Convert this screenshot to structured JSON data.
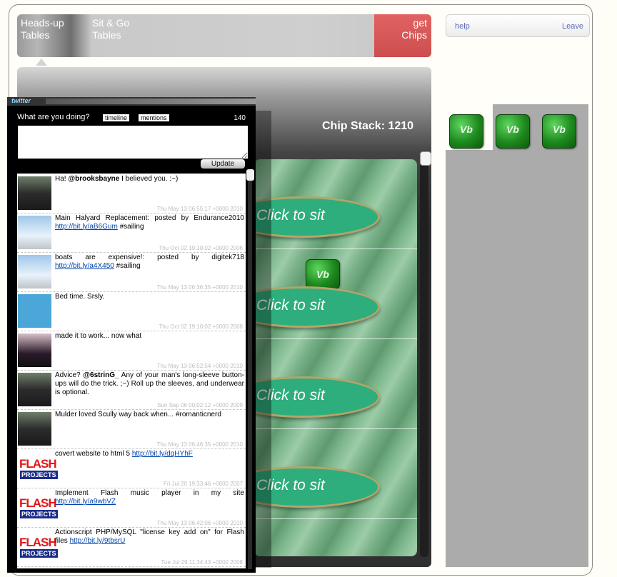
{
  "nav": {
    "headsup": "Heads-up Tables",
    "sitgo": "Sit & Go Tables",
    "getchips": "get Chips"
  },
  "account": {
    "help": "help",
    "leave": "Leave"
  },
  "game": {
    "chip_stack": "Chip Stack: 1210",
    "seats": [
      "Click to sit",
      "Click to sit",
      "Click to sit",
      "Click to sit"
    ],
    "chip_icon_glyph": "Vb"
  },
  "twitter": {
    "logo": "twitter",
    "prompt": "What are you doing?",
    "tabs": [
      "timeline",
      "mentions"
    ],
    "char_count": "140",
    "update_label": "Update",
    "tweets": [
      {
        "avatar": "photo",
        "pre": "Ha! ",
        "bold": "@brooksbayne",
        "post": "  I believed you. :~)",
        "link": "",
        "tail": "",
        "time": "Thu May 13 06:55:17 +0000 2010"
      },
      {
        "avatar": "boat",
        "pre": "Main Halyard Replacement: posted by Endurance2010 ",
        "bold": "",
        "post": "",
        "link": "http://bit.ly/aB6Gum",
        "tail": " #sailing",
        "time": "Thu Oct 02 19:10:02 +0000 2008"
      },
      {
        "avatar": "boat",
        "pre": "boats are expensive!: posted by digitek718 ",
        "bold": "",
        "post": "",
        "link": "http://bit.ly/a4X450",
        "tail": " #sailing",
        "time": "Thu May 13 06:36:35 +0000 2010"
      },
      {
        "avatar": "duck",
        "pre": "Bed time. Srsly.",
        "bold": "",
        "post": "",
        "link": "",
        "tail": "",
        "time": "Thu Oct 02 19:10:02 +0000 2008"
      },
      {
        "avatar": "girl",
        "pre": "made it to work... now what",
        "bold": "",
        "post": "",
        "link": "",
        "tail": "",
        "time": "Thu May 13 06:52:54 +0000 2010"
      },
      {
        "avatar": "photo",
        "pre": "Advice? ",
        "bold": "@6strinG_",
        "post": "  Any of your man's long-sleeve button-ups will do the trick. ;~) Roll up the sleeves, and underwear is optional.",
        "link": "",
        "tail": "",
        "time": "Sun Sep 06 00:02:12 +0000 2009"
      },
      {
        "avatar": "photo",
        "pre": "Mulder loved Scully way back when... #romanticnerd",
        "bold": "",
        "post": "",
        "link": "",
        "tail": "",
        "time": "Thu May 13 06:46:35 +0000 2010"
      },
      {
        "avatar": "flash",
        "pre": "covert website to html 5 ",
        "bold": "",
        "post": "",
        "link": "http://bit.ly/dqHYhF",
        "tail": "",
        "time": "Fri Jul 20 19:33:46 +0000 2007"
      },
      {
        "avatar": "flash",
        "pre": "Implement Flash music player in my site ",
        "bold": "",
        "post": "",
        "link": "http://bit.ly/a9wbVZ",
        "tail": "",
        "time": "Thu May 13 06:42:06 +0000 2010"
      },
      {
        "avatar": "flash",
        "pre": "Actionscript PHP/MySQL \"license key add on\" for Flash files ",
        "bold": "",
        "post": "",
        "link": "http://bit.ly/9tbsrU",
        "tail": "",
        "time": "Tue Jul 29 11:34:43 +0000 2008"
      }
    ],
    "flash_logo_top": "FLASH",
    "flash_logo_bottom": "PROJECTS"
  }
}
